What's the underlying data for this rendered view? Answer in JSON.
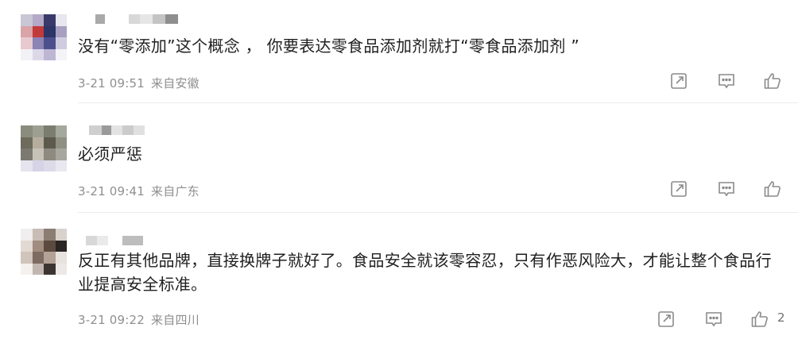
{
  "comments": [
    {
      "text": "没有“零添加”这个概念 ， 你要表达零食品添加剂就打“零食品添加剂 ”",
      "date": "3-21 09:51",
      "location": "来自安徽",
      "likes": ""
    },
    {
      "text": "必须严惩",
      "date": "3-21 09:41",
      "location": "来自广东",
      "likes": ""
    },
    {
      "text": "反正有其他品牌，直接换牌子就好了。食品安全就该零容忍，只有作恶风险大，才能让整个食品行业提高安全标准。",
      "date": "3-21 09:22",
      "location": "来自四川",
      "likes": "2"
    }
  ],
  "icons": {
    "share": "share-icon",
    "reply": "comment-icon",
    "like": "thumbs-up-icon"
  },
  "colors": {
    "text": "#1f1f1f",
    "meta": "#8f8f8f",
    "icon": "#8a8a8a",
    "divider": "#ececec"
  }
}
